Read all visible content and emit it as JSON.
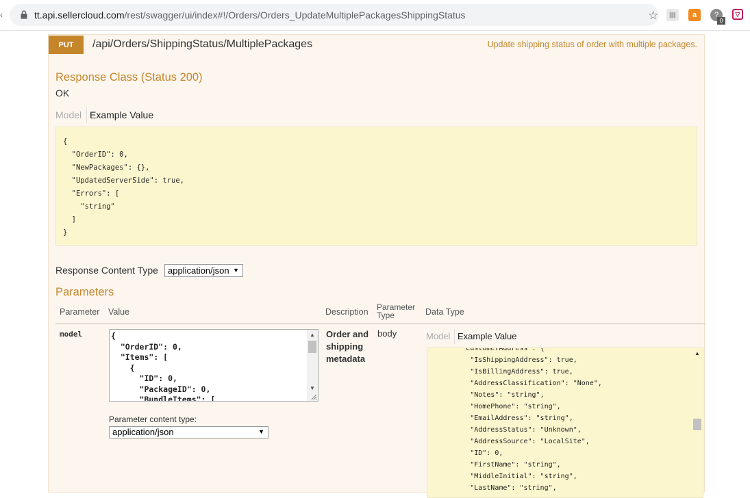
{
  "browser": {
    "url_host": "tt.api.sellercloud.com",
    "url_path": "/rest/swagger/ui/index#!/Orders/Orders_UpdateMultiplePackagesShippingStatus",
    "extension_badge_count": "0"
  },
  "operation": {
    "method": "PUT",
    "path": "/api/Orders/ShippingStatus/MultiplePackages",
    "summary": "Update shipping status of order with multiple packages.",
    "response_class_heading": "Response Class (Status 200)",
    "response_class_value": "OK",
    "model_tab": "Model",
    "example_value_tab": "Example Value",
    "response_example": "{\n  \"OrderID\": 0,\n  \"NewPackages\": {},\n  \"UpdatedServerSide\": true,\n  \"Errors\": [\n    \"string\"\n  ]\n}",
    "response_content_type_label": "Response Content Type",
    "response_content_type_value": "application/json",
    "parameters_heading": "Parameters",
    "table_headers": {
      "parameter": "Parameter",
      "value": "Value",
      "description": "Description",
      "parameter_type_line1": "Parameter",
      "parameter_type_line2": "Type",
      "data_type": "Data Type"
    },
    "param": {
      "name": "model",
      "value_text": "{\n  \"OrderID\": 0,\n  \"Items\": [\n    {\n      \"ID\": 0,\n      \"PackageID\": 0,\n      \"BundleItems\": [",
      "description": "Order and shipping metadata",
      "param_type": "body",
      "content_type_label": "Parameter content type:",
      "content_type_value": "application/json",
      "model_tab": "Model",
      "example_value_tab": "Example Value",
      "example_text": "        \"CustomerAddress\": {\n          \"IsShippingAddress\": true,\n          \"IsBillingAddress\": true,\n          \"AddressClassification\": \"None\",\n          \"Notes\": \"string\",\n          \"HomePhone\": \"string\",\n          \"EmailAddress\": \"string\",\n          \"AddressStatus\": \"Unknown\",\n          \"AddressSource\": \"LocalSite\",\n          \"ID\": 0,\n          \"FirstName\": \"string\",\n          \"MiddleInitial\": \"string\",\n          \"LastName\": \"string\","
    }
  },
  "colors": {
    "accent": "#c5862b",
    "panel_bg": "#fcf6ef",
    "snippet_bg": "#fcf6cf"
  }
}
